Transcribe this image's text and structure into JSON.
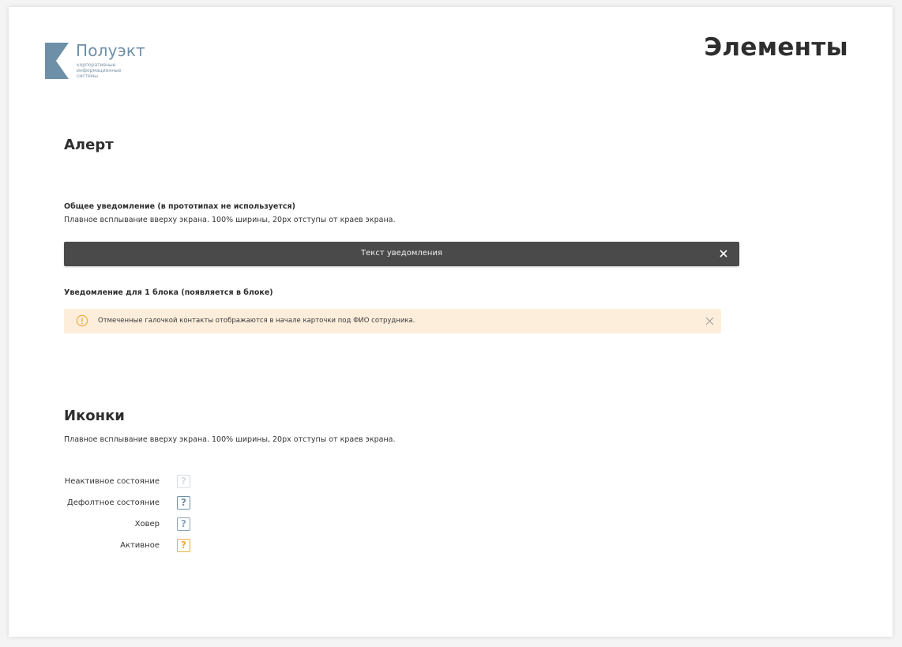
{
  "logo": {
    "name": "Полуэкт",
    "sub_lines": [
      "корпоративные",
      "информационные",
      "системы"
    ]
  },
  "page_title": "Элементы",
  "alert_section": {
    "title": "Алерт",
    "general": {
      "heading": "Общее уведомление (в прототипах не используется)",
      "description": "Плавное всплывание вверху экрана. 100% ширины, 20px отступы от краев экрана.",
      "toast_text": "Текст уведомления"
    },
    "block": {
      "heading": "Уведомление для 1 блока (появляется в блоке)",
      "alert_text": "Отмеченные галочкой контакты отображаются в начале карточки под ФИО сотрудника."
    }
  },
  "icons_section": {
    "title": "Иконки",
    "description": "Плавное всплывание вверху экрана. 100% ширины, 20px отступы от краев экрана.",
    "states": [
      {
        "label": "Неактивное состояние",
        "glyph": "?",
        "color": "#d6dee3"
      },
      {
        "label": "Дефолтное состояние",
        "glyph": "?",
        "color": "#6e8fa8"
      },
      {
        "label": "Ховер",
        "glyph": "?",
        "color": "#8aa4b5"
      },
      {
        "label": "Активное",
        "glyph": "?",
        "color": "#f0ad3c"
      }
    ]
  },
  "colors": {
    "brand": "#6e8fa8",
    "toast_bg": "#4a4a4a",
    "alert_bg": "#fdeedc",
    "alert_icon": "#f0ad3c"
  }
}
